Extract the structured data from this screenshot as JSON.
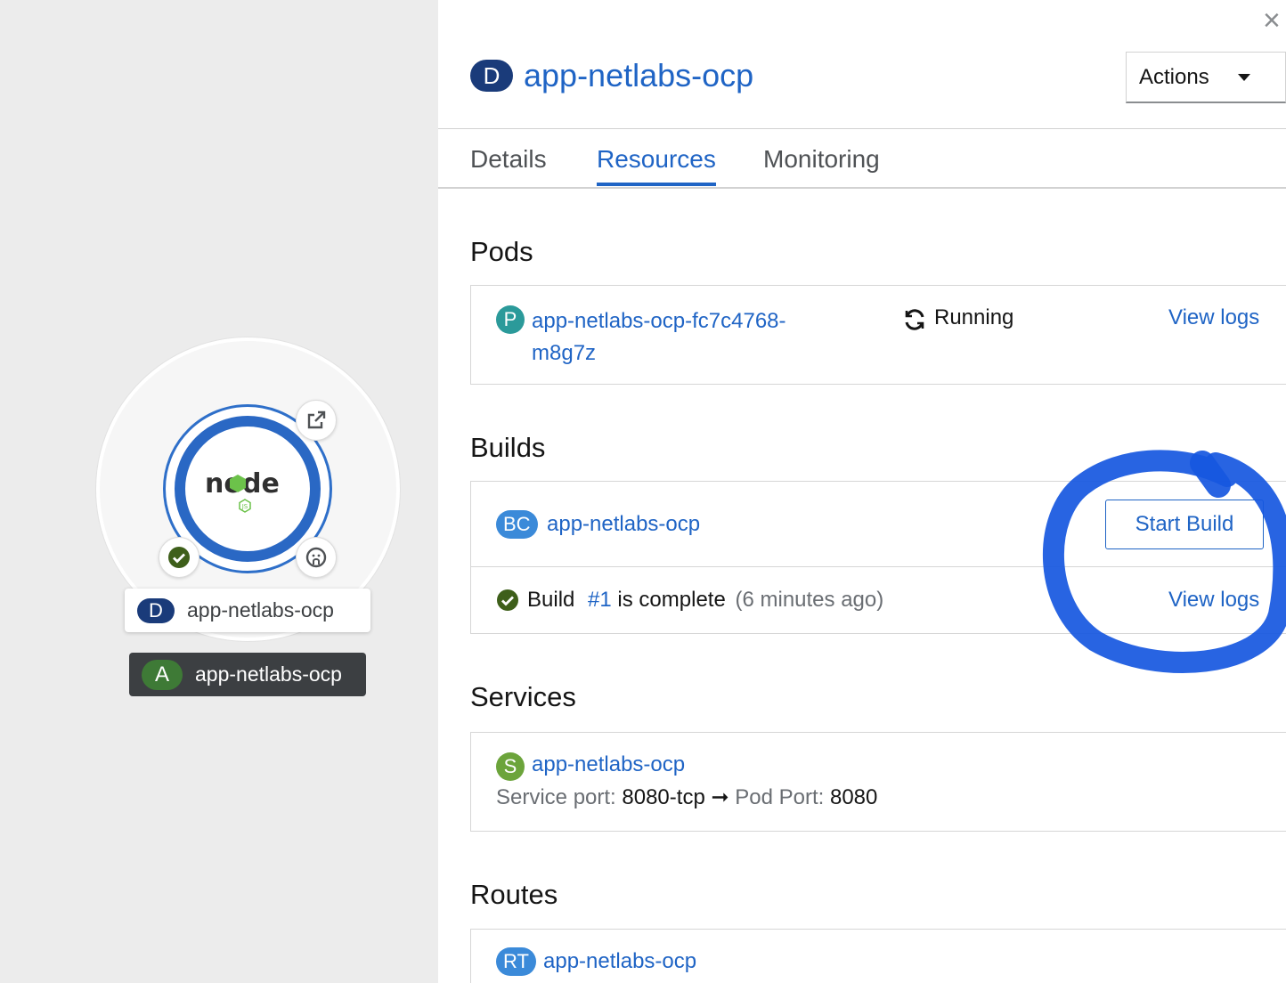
{
  "topology": {
    "deployment": {
      "badge": "D",
      "name": "app-netlabs-ocp"
    },
    "application": {
      "badge": "A",
      "name": "app-netlabs-ocp"
    },
    "runtime_logo_text": "node",
    "runtime_logo_sub": "JS",
    "icons": {
      "open_url": "external-link-icon",
      "status": "check-circle-icon",
      "source": "github-icon"
    },
    "colors": {
      "node_ring": "#2a68c4",
      "status_green": "#3e8635"
    }
  },
  "panel": {
    "close_label": "×",
    "title": {
      "badge": "D",
      "name": "app-netlabs-ocp"
    },
    "actions_label": "Actions",
    "tabs": [
      {
        "label": "Details",
        "active": false
      },
      {
        "label": "Resources",
        "active": true
      },
      {
        "label": "Monitoring",
        "active": false
      }
    ]
  },
  "pods": {
    "title": "Pods",
    "items": [
      {
        "badge": "P",
        "name_line1": "app-netlabs-ocp-fc7c4768-",
        "name_line2": "m8g7z",
        "status": "Running",
        "logs_label": "View logs"
      }
    ]
  },
  "builds": {
    "title": "Builds",
    "config": {
      "badge": "BC",
      "name": "app-netlabs-ocp",
      "button_label": "Start Build"
    },
    "latest": {
      "prefix": "Build",
      "number": "#1",
      "suffix": "is complete",
      "age": "(6 minutes ago)",
      "logs_label": "View logs"
    }
  },
  "services": {
    "title": "Services",
    "items": [
      {
        "badge": "S",
        "name": "app-netlabs-ocp",
        "service_port_label": "Service port:",
        "service_port": "8080-tcp",
        "arrow": "➞",
        "pod_port_label": "Pod Port:",
        "pod_port": "8080"
      }
    ]
  },
  "routes": {
    "title": "Routes",
    "items": [
      {
        "badge": "RT",
        "name": "app-netlabs-ocp"
      }
    ]
  },
  "badge_colors": {
    "D": "#1a3b7a",
    "A": "#3e7a36",
    "P": "#2b9a9a",
    "BC": "#3b8ad9",
    "S": "#6ca43b",
    "RT": "#3b8ad9"
  },
  "annotation_color": "#1657e0"
}
